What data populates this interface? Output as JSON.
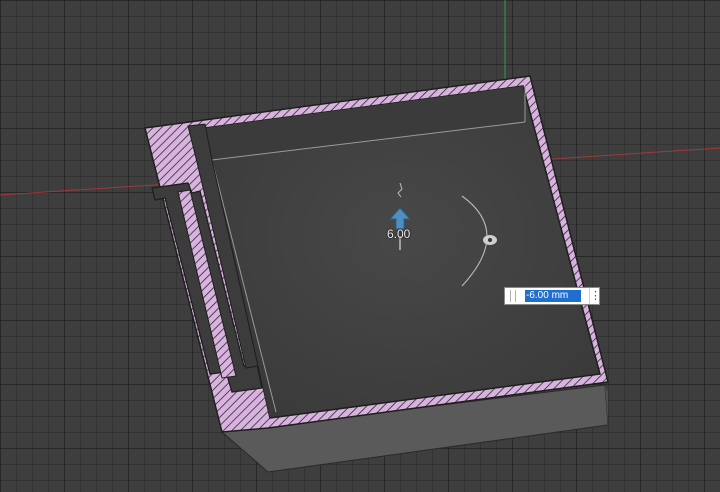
{
  "viewport": {
    "grid_color": "#2e2e2e",
    "background": "#3e3e3e",
    "x_axis_color": "#b83a3a",
    "y_axis_color": "#2fa84a"
  },
  "model": {
    "section_fill": "#d9b3df",
    "hatch_color": "#2a2a2a",
    "inner_floor_color": "#454545"
  },
  "manipulator": {
    "arrow_icon": "arrow-up-icon",
    "arrow_color": "#4f8fc0",
    "value_label": "6.00"
  },
  "dimension_input": {
    "value": "-6.00 mm",
    "menu_icon": "more-vertical-icon",
    "selection_color": "#1f6fd1"
  }
}
